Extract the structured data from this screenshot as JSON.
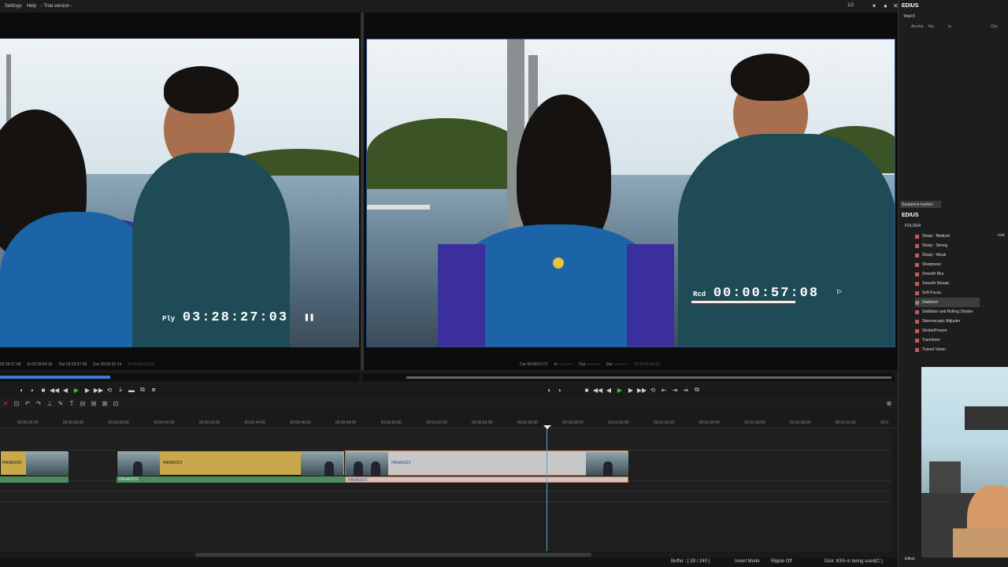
{
  "menubar": {
    "settings": "Settings",
    "help": "Help",
    "trial": "- Trial version -",
    "page": "1/2"
  },
  "player": {
    "tc_label": "Ply",
    "timecode": "03:28:27:03",
    "info": [
      "03:28:27:06",
      "In 03:28:54:16",
      "Out 03:28:27:06",
      "Dur 00:00:32:14",
      "Ttl 00:01:12:00"
    ]
  },
  "recorder": {
    "tc_label": "Rcd",
    "timecode": "00:00:57:08",
    "info": [
      "Cur 00:00:57:07",
      "In --:--:--:--",
      "Out --:--:--:--",
      "Dur --:--:--:--",
      "Ttl 00:01:00:22"
    ]
  },
  "ruler": [
    "00:00:34:00",
    "00:00:36:00",
    "00:00:38:00",
    "00:00:40:00",
    "00:00:42:00",
    "00:00:44:00",
    "00:00:46:00",
    "00:00:48:00",
    "00:00:50:00",
    "00:00:52:00",
    "00:00:54:00",
    "00:00:56:00",
    "00:00:58:00",
    "00:01:00:00",
    "00:01:02:00",
    "00:01:04:00",
    "00:01:06:00",
    "00:01:08:00",
    "00:01:10:00",
    "00:0"
  ],
  "clips": {
    "c1": "PANA0026",
    "c2": "PANA0023",
    "c3": "PANA0023",
    "a1": "PANA0023",
    "a2": "PANA0023"
  },
  "status": {
    "buffer": "Buffer : [ 39 / 240 ]",
    "insert": "Insert Mode",
    "ripple": "Ripple Off",
    "disk": "Disk :83% is being used(C:)"
  },
  "right_panel": {
    "brand": "EDIUS",
    "total": "Total:0",
    "marker_cols": {
      "anchor": "Anchor",
      "no": "No.",
      "in": "In",
      "out": "Out"
    },
    "seq_marker": "Sequence marker",
    "folder": "FOLDER",
    "root": "root",
    "effects": [
      "Sharp : Medium",
      "Sharp : Strong",
      "Sharp : Weak",
      "Sharpness",
      "Smooth Blur",
      "Smooth Mosaic",
      "Soft Focus",
      "Stabilizer",
      "Stabilizer and Rolling Shutter",
      "Stereoscopic Adjuster",
      "Strobe/Freeze",
      "Transform",
      "Tunnel Vision"
    ],
    "selected_effect": "Stabilizer",
    "bottom_tab": "Effect"
  }
}
